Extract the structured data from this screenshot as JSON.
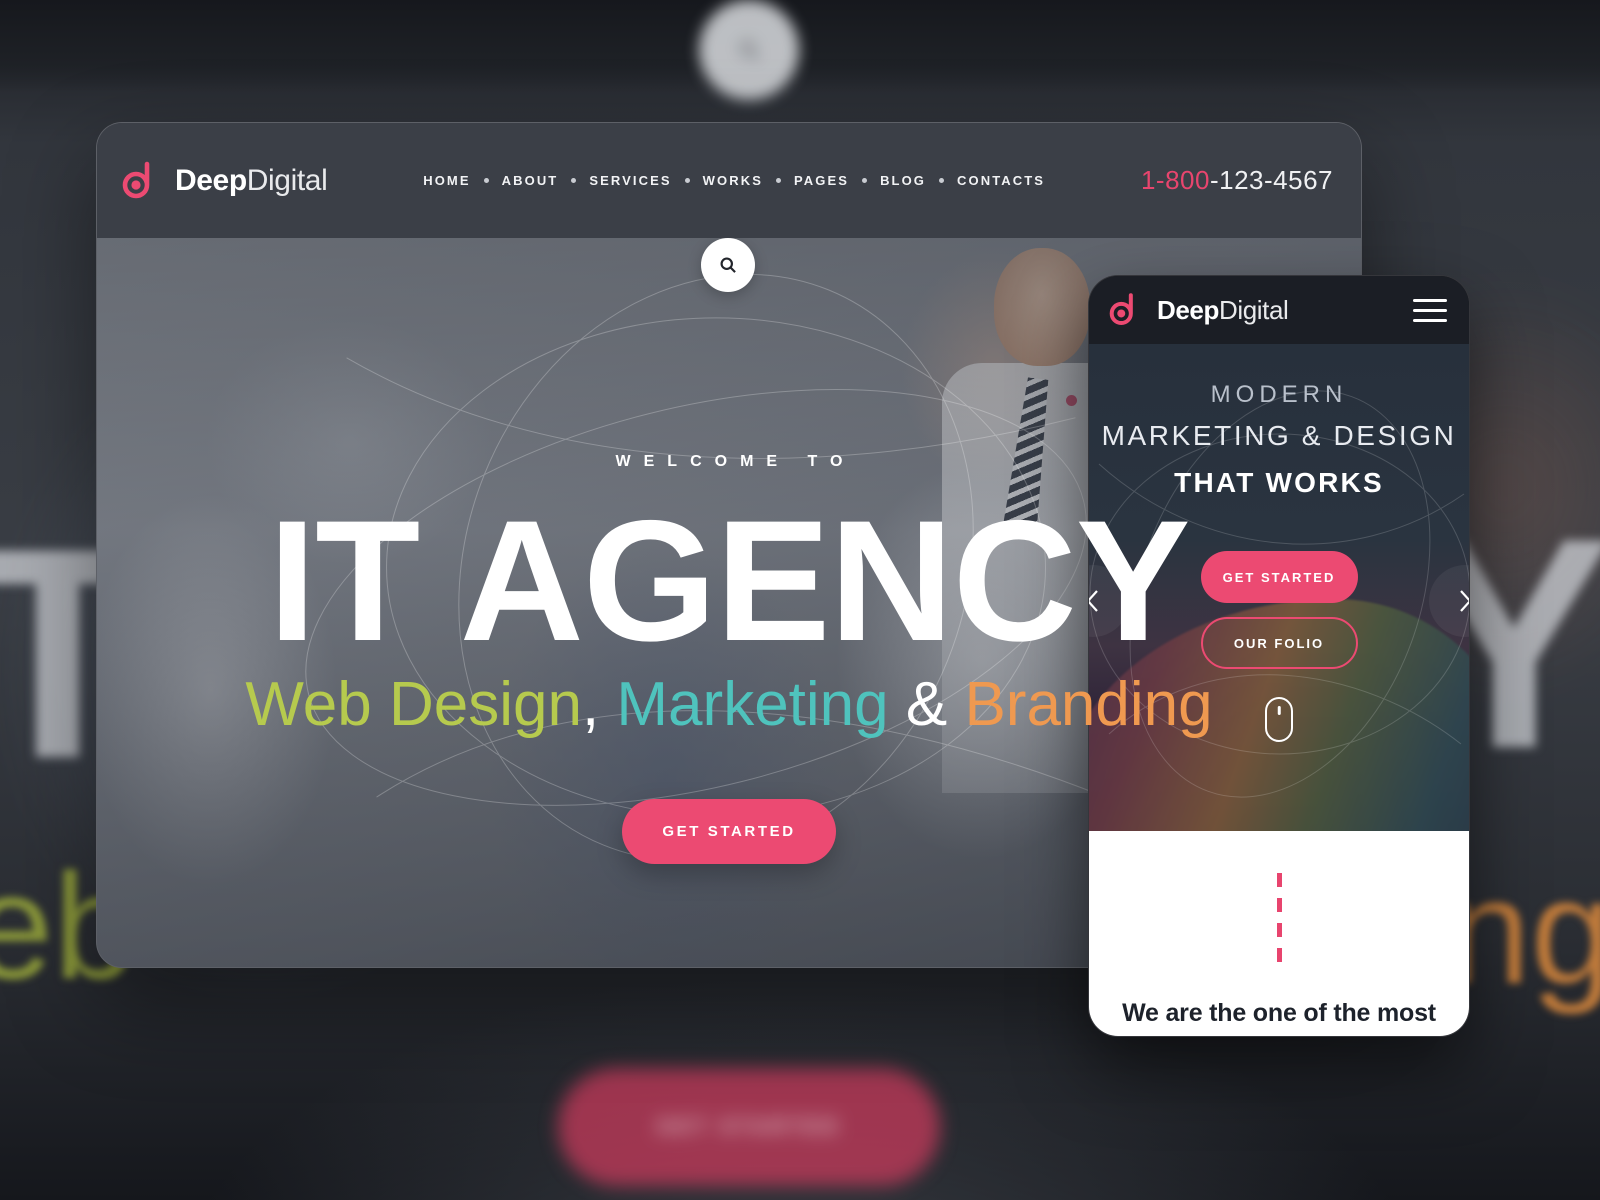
{
  "brand": {
    "name_bold": "Deep",
    "name_light": "Digital",
    "accent_color": "#ec4a72",
    "logo_icon": "deepdigital-d-logo-icon"
  },
  "background": {
    "word_left": "T",
    "word_right": "Y",
    "sub_left": "eb",
    "sub_right": "ng",
    "cta_label": "GET STARTED",
    "search_icon": "search-icon"
  },
  "desktop": {
    "nav_items": [
      {
        "label": "HOME"
      },
      {
        "label": "ABOUT"
      },
      {
        "label": "SERVICES"
      },
      {
        "label": "WORKS"
      },
      {
        "label": "PAGES"
      },
      {
        "label": "BLOG"
      },
      {
        "label": "CONTACTS"
      }
    ],
    "phone": {
      "prefix": "1-800",
      "rest": "-123-4567"
    },
    "search_icon": "search-icon",
    "hero": {
      "welcome": "WELCOME TO",
      "title": "IT AGENCY",
      "subtitle_parts": [
        {
          "text": "Web Design",
          "color": "#b6ca4e"
        },
        {
          "text": ",",
          "color": "#ffffff"
        },
        {
          "text": " Marketing",
          "color": "#4fc3bd"
        },
        {
          "text": " & ",
          "color": "#ffffff"
        },
        {
          "text": "Branding",
          "color": "#ef9950"
        }
      ],
      "subtitle_1": "Web Design",
      "subtitle_comma": ",",
      "subtitle_2": " Marketing",
      "subtitle_amp": " & ",
      "subtitle_3": "Branding",
      "cta_label": "GET STARTED"
    }
  },
  "mobile": {
    "menu_icon": "hamburger-menu-icon",
    "slide": {
      "line1": "MODERN",
      "line2": "MARKETING & DESIGN",
      "line3": "THAT WORKS"
    },
    "prev_icon": "chevron-left-icon",
    "next_icon": "chevron-right-icon",
    "cta_primary": "GET STARTED",
    "cta_secondary": "OUR FOLIO",
    "scroll_icon": "mouse-scroll-icon",
    "section_text": "We are the one of the most"
  }
}
